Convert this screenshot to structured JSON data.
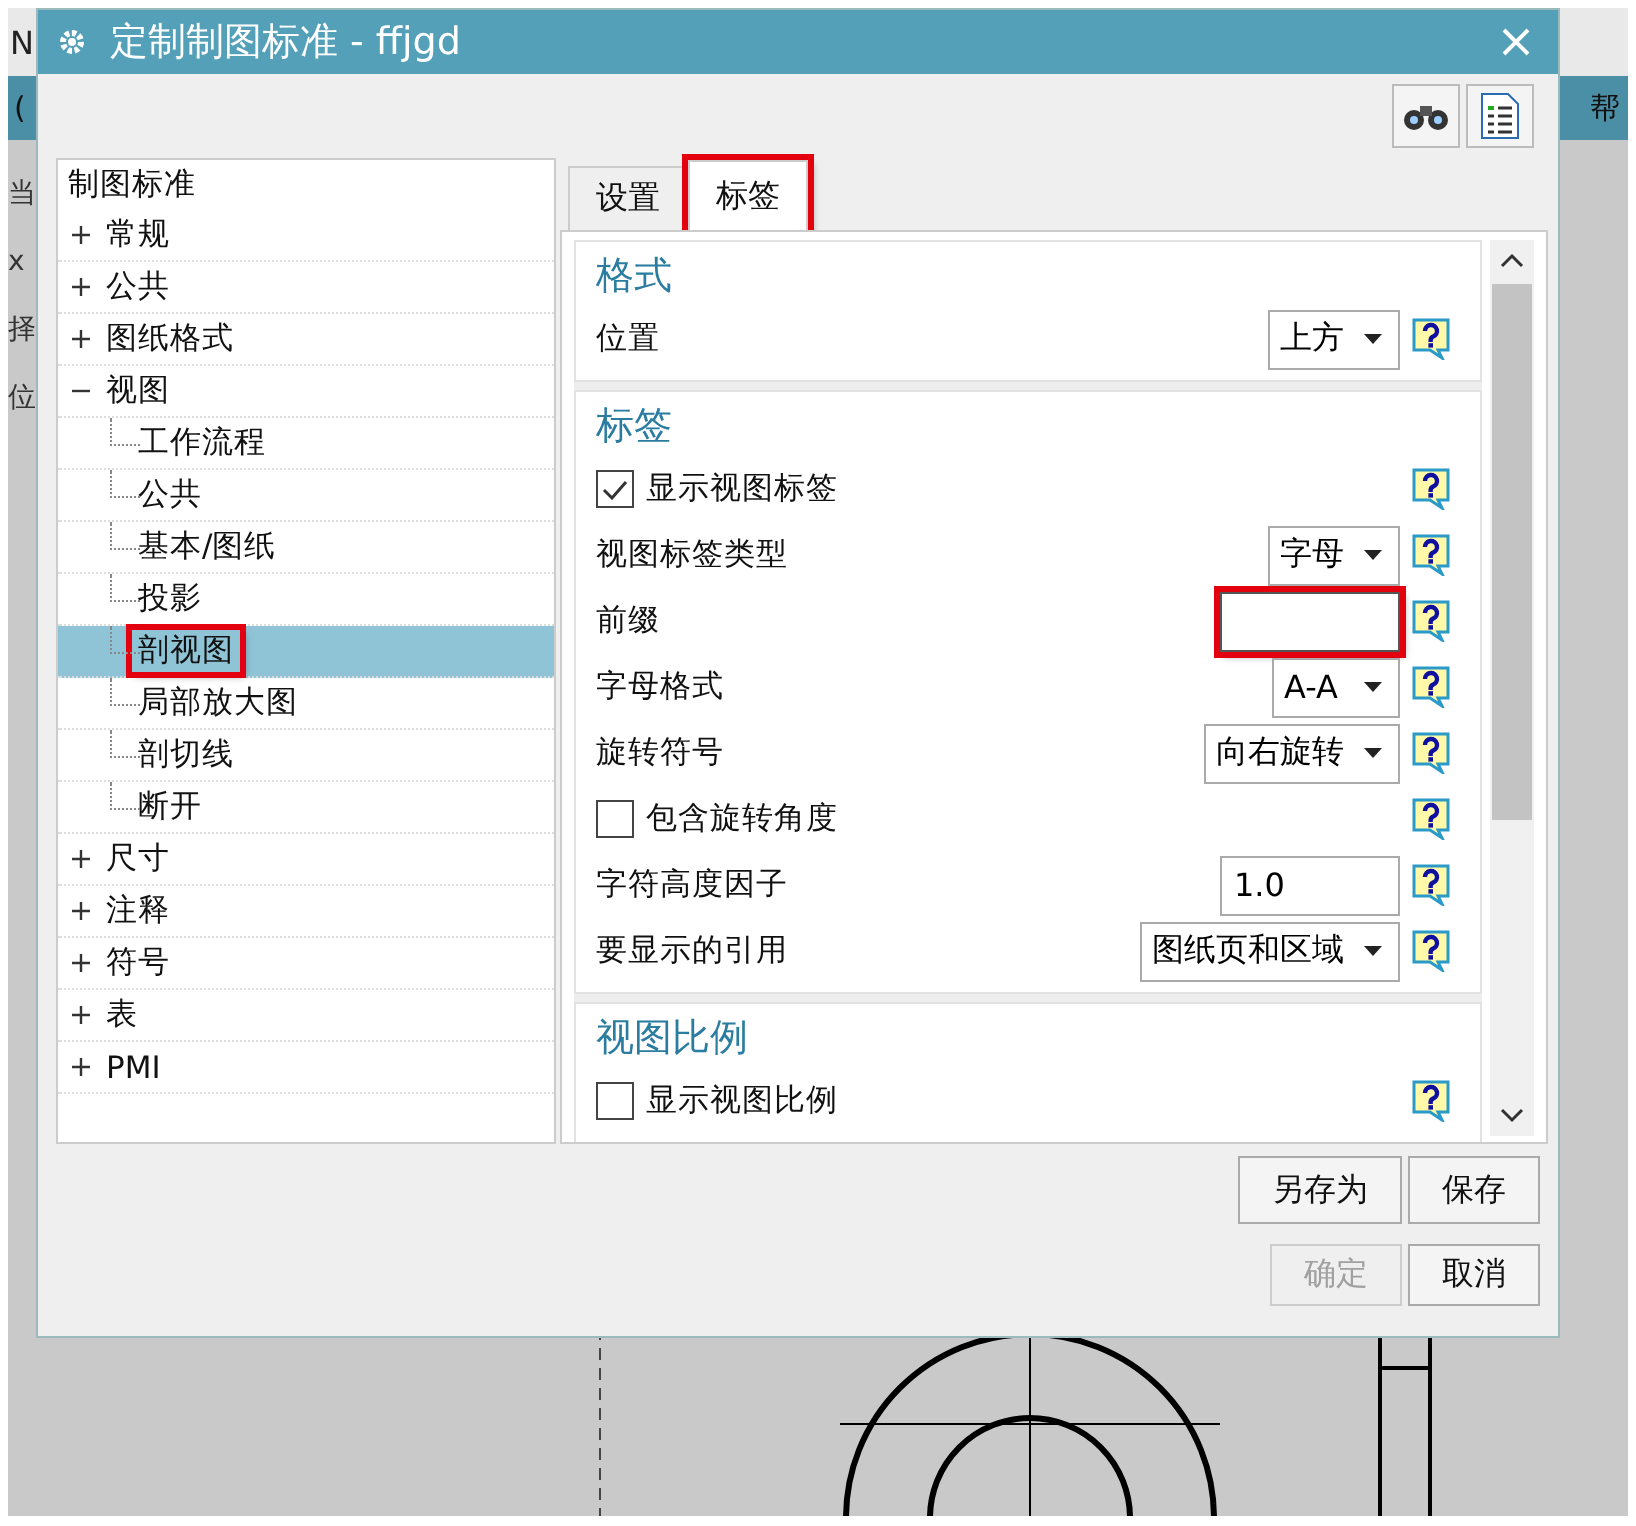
{
  "background_app": {
    "title_fragment": "N",
    "menu_fragment": "(",
    "menu_fragment_right": "帮",
    "side_fragments": [
      "当",
      "x",
      "择",
      "位"
    ]
  },
  "window": {
    "title": "定制制图标准 - ffjgd"
  },
  "tree": {
    "header": "制图标准",
    "items": [
      {
        "label": "常规",
        "expanded": false,
        "selected": false,
        "highlighted": false
      },
      {
        "label": "公共",
        "expanded": false,
        "selected": false,
        "highlighted": false
      },
      {
        "label": "图纸格式",
        "expanded": false,
        "selected": false,
        "highlighted": false
      },
      {
        "label": "视图",
        "expanded": true,
        "selected": false,
        "highlighted": false,
        "children": [
          {
            "label": "工作流程",
            "selected": false,
            "highlighted": false
          },
          {
            "label": "公共",
            "selected": false,
            "highlighted": false
          },
          {
            "label": "基本/图纸",
            "selected": false,
            "highlighted": false
          },
          {
            "label": "投影",
            "selected": false,
            "highlighted": false
          },
          {
            "label": "剖视图",
            "selected": true,
            "highlighted": true
          },
          {
            "label": "局部放大图",
            "selected": false,
            "highlighted": false
          },
          {
            "label": "剖切线",
            "selected": false,
            "highlighted": false
          },
          {
            "label": "断开",
            "selected": false,
            "highlighted": false
          }
        ]
      },
      {
        "label": "尺寸",
        "expanded": false,
        "selected": false,
        "highlighted": false
      },
      {
        "label": "注释",
        "expanded": false,
        "selected": false,
        "highlighted": false
      },
      {
        "label": "符号",
        "expanded": false,
        "selected": false,
        "highlighted": false
      },
      {
        "label": "表",
        "expanded": false,
        "selected": false,
        "highlighted": false
      },
      {
        "label": "PMI",
        "expanded": false,
        "selected": false,
        "highlighted": false
      }
    ]
  },
  "tabs": [
    {
      "label": "设置",
      "selected": false,
      "highlighted": false
    },
    {
      "label": "标签",
      "selected": true,
      "highlighted": true
    }
  ],
  "sections": [
    {
      "title": "格式",
      "rows": [
        {
          "kind": "dropdown",
          "label": "位置",
          "value": "上方"
        }
      ]
    },
    {
      "title": "标签",
      "rows": [
        {
          "kind": "checkbox",
          "label": "显示视图标签",
          "checked": true
        },
        {
          "kind": "dropdown",
          "label": "视图标签类型",
          "value": "字母"
        },
        {
          "kind": "text",
          "label": "前缀",
          "focused": true,
          "highlighted": true
        },
        {
          "kind": "dropdown",
          "label": "字母格式",
          "value": "A-A"
        },
        {
          "kind": "dropdown",
          "label": "旋转符号",
          "value": "向右旋转"
        },
        {
          "kind": "checkbox",
          "label": "包含旋转角度",
          "checked": false
        },
        {
          "kind": "text",
          "label": "字符高度因子",
          "value": "1.0",
          "focused": false,
          "highlighted": false
        },
        {
          "kind": "dropdown",
          "label": "要显示的引用",
          "value": "图纸页和区域"
        }
      ]
    },
    {
      "title": "视图比例",
      "rows": [
        {
          "kind": "checkbox",
          "label": "显示视图比例",
          "checked": false
        }
      ]
    }
  ],
  "buttons": [
    {
      "label": "另存为",
      "disabled": false
    },
    {
      "label": "保存",
      "disabled": false
    },
    {
      "label": "确定",
      "disabled": true
    },
    {
      "label": "取消",
      "disabled": false
    }
  ]
}
